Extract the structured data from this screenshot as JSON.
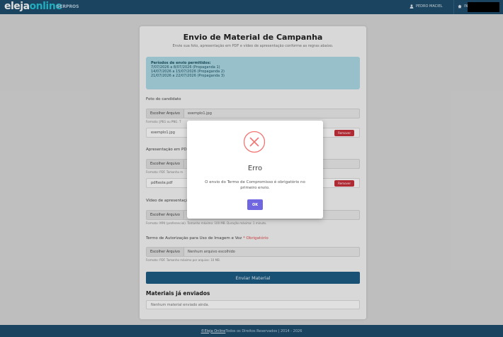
{
  "header": {
    "brand_main": "eleja",
    "brand_accent": "online",
    "brand_sub": "SERPROS",
    "user_name": "PEDRO MACIEL",
    "home_label": "IN"
  },
  "page": {
    "title": "Envio de Material de Campanha",
    "subtitle": "Envie sua foto, apresentação em PDF e vídeo de apresentação conforme as regras abaixo."
  },
  "info": {
    "title": "Períodos de envio permitidos:",
    "periods": [
      "7/07/2026 a 8/07/2026 (Propaganda 1)",
      "14/07/2026 a 15/07/2026 (Propaganda 2)",
      "21/07/2026 a 22/07/2026 (Propaganda 3)"
    ]
  },
  "photo": {
    "label": "Foto do candidato",
    "choose": "Escolher Arquivo",
    "value": "exemplo1.jpg",
    "hint": "Formato: JPEG ou PNG. T",
    "file": "exemplo1.jpg",
    "remove": "Remover"
  },
  "pdf": {
    "label": "Apresentação em PDF",
    "choose": "Escolher Arquivo",
    "hint": "Formato: PDF. Tamanho m",
    "file": "pdfteste.pdf",
    "remove": "Remover"
  },
  "video": {
    "label": "Vídeo de apresentação",
    "choose": "Escolher Arquivo",
    "hint": "Formato: MP4 (preferencial). Tamanho máximo: 100 MB. Duração máxima: 1 minuto."
  },
  "term": {
    "label": "Termo de Autorização para Uso de Imagem e Voz",
    "required": "* Obrigatório",
    "choose": "Escolher Arquivo",
    "value": "Nenhum arquivo escolhido",
    "hint": "Formato: PDF. Tamanho máximo por arquivo: 10 MB."
  },
  "submit_label": "Enviar Material",
  "sent": {
    "title": "Materiais já enviados",
    "empty": "Nenhum material enviado ainda."
  },
  "footer": {
    "link": "©Eleja Online",
    "text": " Todos os Direitos Reservados | 2014 - 2026"
  },
  "modal": {
    "title": "Erro",
    "message": "O envio do Termo de Compromisso é obrigatório no primeiro envio.",
    "ok": "OK"
  },
  "colors": {
    "navbar": "#1f4e6e",
    "brand_accent": "#27c3d8",
    "info_bg": "#aedbe7",
    "remove": "#c9303b",
    "submit": "#1d5d86",
    "ok": "#7066e0",
    "error": "#f27474"
  },
  "icons": {
    "user": "user-icon",
    "home": "home-icon",
    "error": "error-x-icon"
  }
}
